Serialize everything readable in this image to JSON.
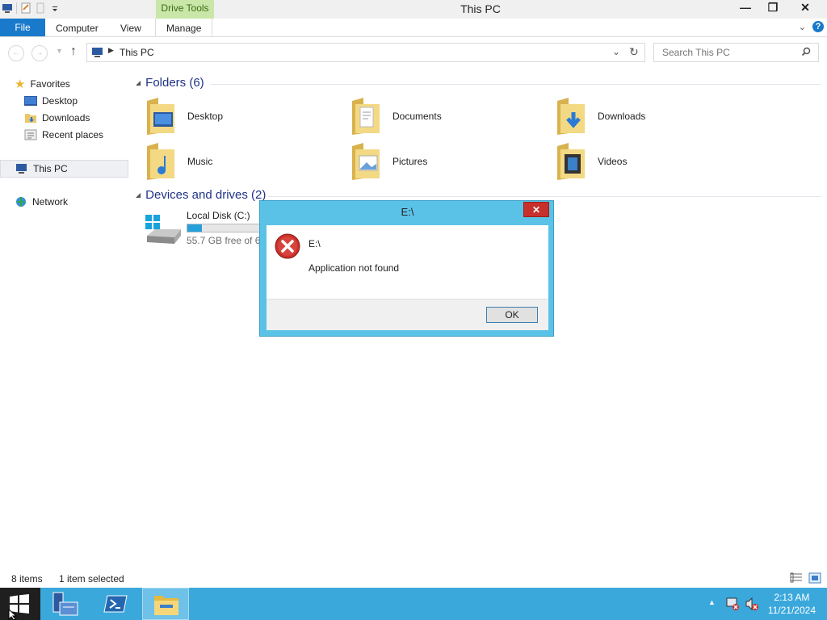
{
  "window": {
    "title": "This PC",
    "drive_tools_tab": "Drive Tools"
  },
  "ribbon": {
    "tabs": [
      "File",
      "Computer",
      "View",
      "Manage"
    ]
  },
  "address": {
    "path": "This PC"
  },
  "search": {
    "placeholder": "Search This PC"
  },
  "sidebar": {
    "favorites": "Favorites",
    "fav_items": [
      "Desktop",
      "Downloads",
      "Recent places"
    ],
    "this_pc": "This PC",
    "network": "Network"
  },
  "content": {
    "folders_header": "Folders (6)",
    "folders": [
      "Desktop",
      "Documents",
      "Downloads",
      "Music",
      "Pictures",
      "Videos"
    ],
    "drives_header": "Devices and drives (2)",
    "drive": {
      "name": "Local Disk (C:)",
      "free": "55.7 GB free of 69",
      "used_fraction": 0.19
    }
  },
  "dialog": {
    "title": "E:\\",
    "heading": "E:\\",
    "message": "Application not found",
    "ok_label": "OK"
  },
  "status": {
    "items": "8 items",
    "selected": "1 item selected"
  },
  "taskbar": {
    "time": "2:13 AM",
    "date": "11/21/2024"
  },
  "colors": {
    "accent": "#1979ca",
    "taskbar": "#3ba8dc",
    "dialog_frame": "#5bc2e7",
    "error_red": "#c7302b"
  }
}
